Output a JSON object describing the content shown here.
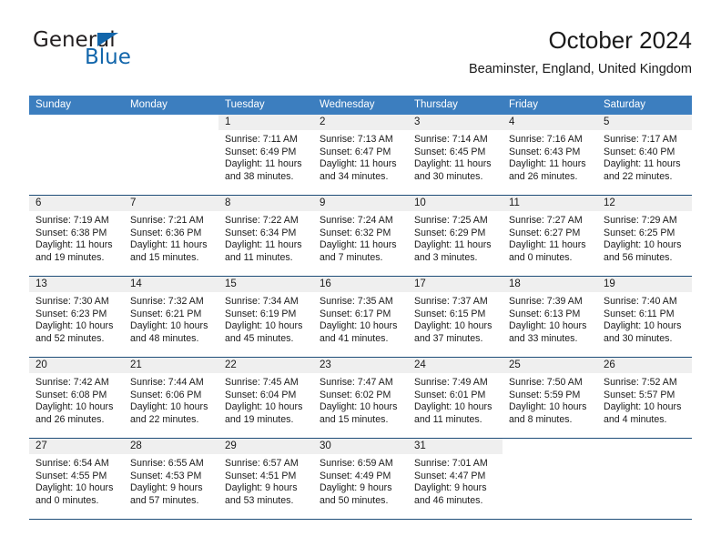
{
  "brand": {
    "name_top": "General",
    "name_bottom": "Blue",
    "triangle_color": "#1266ab",
    "top_color": "#231f20",
    "bottom_color": "#1266ab"
  },
  "header": {
    "title": "October 2024",
    "subtitle": "Beaminster, England, United Kingdom"
  },
  "theme": {
    "header_bg": "#3c7ebf",
    "header_text": "#ffffff",
    "daynum_bg": "#efefef",
    "rule_color": "#1f4e79",
    "body_text": "#1a1a1a"
  },
  "weekdays": [
    "Sunday",
    "Monday",
    "Tuesday",
    "Wednesday",
    "Thursday",
    "Friday",
    "Saturday"
  ],
  "weeks": [
    [
      {
        "day": "",
        "empty": true,
        "blank": true,
        "sunrise": "",
        "sunset": "",
        "daylight1": "",
        "daylight2": ""
      },
      {
        "day": "",
        "empty": true,
        "blank": true,
        "sunrise": "",
        "sunset": "",
        "daylight1": "",
        "daylight2": ""
      },
      {
        "day": "1",
        "sunrise": "Sunrise: 7:11 AM",
        "sunset": "Sunset: 6:49 PM",
        "daylight1": "Daylight: 11 hours",
        "daylight2": "and 38 minutes."
      },
      {
        "day": "2",
        "sunrise": "Sunrise: 7:13 AM",
        "sunset": "Sunset: 6:47 PM",
        "daylight1": "Daylight: 11 hours",
        "daylight2": "and 34 minutes."
      },
      {
        "day": "3",
        "sunrise": "Sunrise: 7:14 AM",
        "sunset": "Sunset: 6:45 PM",
        "daylight1": "Daylight: 11 hours",
        "daylight2": "and 30 minutes."
      },
      {
        "day": "4",
        "sunrise": "Sunrise: 7:16 AM",
        "sunset": "Sunset: 6:43 PM",
        "daylight1": "Daylight: 11 hours",
        "daylight2": "and 26 minutes."
      },
      {
        "day": "5",
        "sunrise": "Sunrise: 7:17 AM",
        "sunset": "Sunset: 6:40 PM",
        "daylight1": "Daylight: 11 hours",
        "daylight2": "and 22 minutes."
      }
    ],
    [
      {
        "day": "6",
        "sunrise": "Sunrise: 7:19 AM",
        "sunset": "Sunset: 6:38 PM",
        "daylight1": "Daylight: 11 hours",
        "daylight2": "and 19 minutes."
      },
      {
        "day": "7",
        "sunrise": "Sunrise: 7:21 AM",
        "sunset": "Sunset: 6:36 PM",
        "daylight1": "Daylight: 11 hours",
        "daylight2": "and 15 minutes."
      },
      {
        "day": "8",
        "sunrise": "Sunrise: 7:22 AM",
        "sunset": "Sunset: 6:34 PM",
        "daylight1": "Daylight: 11 hours",
        "daylight2": "and 11 minutes."
      },
      {
        "day": "9",
        "sunrise": "Sunrise: 7:24 AM",
        "sunset": "Sunset: 6:32 PM",
        "daylight1": "Daylight: 11 hours",
        "daylight2": "and 7 minutes."
      },
      {
        "day": "10",
        "sunrise": "Sunrise: 7:25 AM",
        "sunset": "Sunset: 6:29 PM",
        "daylight1": "Daylight: 11 hours",
        "daylight2": "and 3 minutes."
      },
      {
        "day": "11",
        "sunrise": "Sunrise: 7:27 AM",
        "sunset": "Sunset: 6:27 PM",
        "daylight1": "Daylight: 11 hours",
        "daylight2": "and 0 minutes."
      },
      {
        "day": "12",
        "sunrise": "Sunrise: 7:29 AM",
        "sunset": "Sunset: 6:25 PM",
        "daylight1": "Daylight: 10 hours",
        "daylight2": "and 56 minutes."
      }
    ],
    [
      {
        "day": "13",
        "sunrise": "Sunrise: 7:30 AM",
        "sunset": "Sunset: 6:23 PM",
        "daylight1": "Daylight: 10 hours",
        "daylight2": "and 52 minutes."
      },
      {
        "day": "14",
        "sunrise": "Sunrise: 7:32 AM",
        "sunset": "Sunset: 6:21 PM",
        "daylight1": "Daylight: 10 hours",
        "daylight2": "and 48 minutes."
      },
      {
        "day": "15",
        "sunrise": "Sunrise: 7:34 AM",
        "sunset": "Sunset: 6:19 PM",
        "daylight1": "Daylight: 10 hours",
        "daylight2": "and 45 minutes."
      },
      {
        "day": "16",
        "sunrise": "Sunrise: 7:35 AM",
        "sunset": "Sunset: 6:17 PM",
        "daylight1": "Daylight: 10 hours",
        "daylight2": "and 41 minutes."
      },
      {
        "day": "17",
        "sunrise": "Sunrise: 7:37 AM",
        "sunset": "Sunset: 6:15 PM",
        "daylight1": "Daylight: 10 hours",
        "daylight2": "and 37 minutes."
      },
      {
        "day": "18",
        "sunrise": "Sunrise: 7:39 AM",
        "sunset": "Sunset: 6:13 PM",
        "daylight1": "Daylight: 10 hours",
        "daylight2": "and 33 minutes."
      },
      {
        "day": "19",
        "sunrise": "Sunrise: 7:40 AM",
        "sunset": "Sunset: 6:11 PM",
        "daylight1": "Daylight: 10 hours",
        "daylight2": "and 30 minutes."
      }
    ],
    [
      {
        "day": "20",
        "sunrise": "Sunrise: 7:42 AM",
        "sunset": "Sunset: 6:08 PM",
        "daylight1": "Daylight: 10 hours",
        "daylight2": "and 26 minutes."
      },
      {
        "day": "21",
        "sunrise": "Sunrise: 7:44 AM",
        "sunset": "Sunset: 6:06 PM",
        "daylight1": "Daylight: 10 hours",
        "daylight2": "and 22 minutes."
      },
      {
        "day": "22",
        "sunrise": "Sunrise: 7:45 AM",
        "sunset": "Sunset: 6:04 PM",
        "daylight1": "Daylight: 10 hours",
        "daylight2": "and 19 minutes."
      },
      {
        "day": "23",
        "sunrise": "Sunrise: 7:47 AM",
        "sunset": "Sunset: 6:02 PM",
        "daylight1": "Daylight: 10 hours",
        "daylight2": "and 15 minutes."
      },
      {
        "day": "24",
        "sunrise": "Sunrise: 7:49 AM",
        "sunset": "Sunset: 6:01 PM",
        "daylight1": "Daylight: 10 hours",
        "daylight2": "and 11 minutes."
      },
      {
        "day": "25",
        "sunrise": "Sunrise: 7:50 AM",
        "sunset": "Sunset: 5:59 PM",
        "daylight1": "Daylight: 10 hours",
        "daylight2": "and 8 minutes."
      },
      {
        "day": "26",
        "sunrise": "Sunrise: 7:52 AM",
        "sunset": "Sunset: 5:57 PM",
        "daylight1": "Daylight: 10 hours",
        "daylight2": "and 4 minutes."
      }
    ],
    [
      {
        "day": "27",
        "sunrise": "Sunrise: 6:54 AM",
        "sunset": "Sunset: 4:55 PM",
        "daylight1": "Daylight: 10 hours",
        "daylight2": "and 0 minutes."
      },
      {
        "day": "28",
        "sunrise": "Sunrise: 6:55 AM",
        "sunset": "Sunset: 4:53 PM",
        "daylight1": "Daylight: 9 hours",
        "daylight2": "and 57 minutes."
      },
      {
        "day": "29",
        "sunrise": "Sunrise: 6:57 AM",
        "sunset": "Sunset: 4:51 PM",
        "daylight1": "Daylight: 9 hours",
        "daylight2": "and 53 minutes."
      },
      {
        "day": "30",
        "sunrise": "Sunrise: 6:59 AM",
        "sunset": "Sunset: 4:49 PM",
        "daylight1": "Daylight: 9 hours",
        "daylight2": "and 50 minutes."
      },
      {
        "day": "31",
        "sunrise": "Sunrise: 7:01 AM",
        "sunset": "Sunset: 4:47 PM",
        "daylight1": "Daylight: 9 hours",
        "daylight2": "and 46 minutes."
      },
      {
        "day": "",
        "empty": true,
        "blank": true,
        "sunrise": "",
        "sunset": "",
        "daylight1": "",
        "daylight2": ""
      },
      {
        "day": "",
        "empty": true,
        "blank": true,
        "sunrise": "",
        "sunset": "",
        "daylight1": "",
        "daylight2": ""
      }
    ]
  ]
}
